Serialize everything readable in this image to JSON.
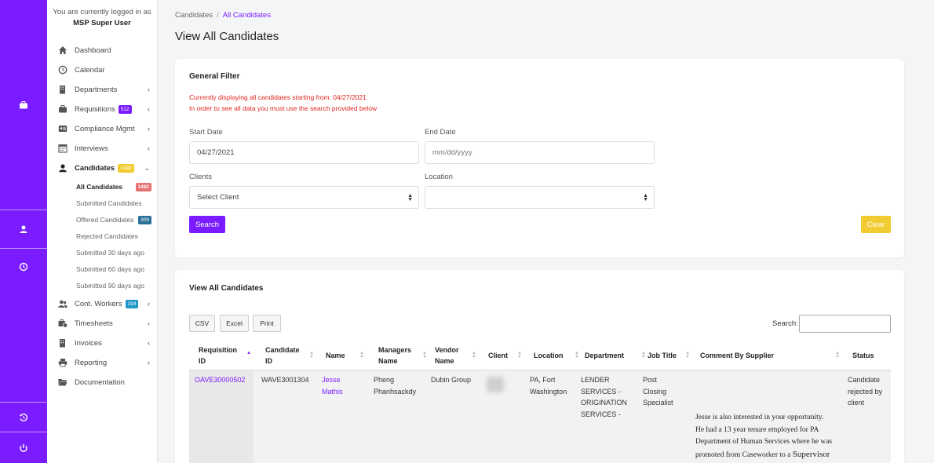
{
  "sidebar": {
    "login_note": "You are currently logged in as",
    "user": "MSP Super User",
    "items": [
      {
        "label": "Dashboard"
      },
      {
        "label": "Calendar"
      },
      {
        "label": "Departments"
      },
      {
        "label": "Requisitions",
        "badge": "512"
      },
      {
        "label": "Compliance Mgmt"
      },
      {
        "label": "Interviews"
      },
      {
        "label": "Candidates",
        "badge": "1492"
      },
      {
        "label": "Cont. Workers",
        "badge": "194"
      },
      {
        "label": "Timesheets"
      },
      {
        "label": "Invoices"
      },
      {
        "label": "Reporting"
      },
      {
        "label": "Documentation"
      }
    ],
    "sub_items": [
      {
        "label": "All Candidates",
        "badge": "1492"
      },
      {
        "label": "Submitted Candidates"
      },
      {
        "label": "Offered Candidates",
        "badge": "309"
      },
      {
        "label": "Rejected Candidates"
      },
      {
        "label": "Submitted 30 days ago"
      },
      {
        "label": "Submitted 60 days ago"
      },
      {
        "label": "Submitted 90 days ago"
      }
    ],
    "colors": {
      "badge_purple": "#7a1cff",
      "badge_yellow": "#f1cb32",
      "badge_red": "#e87171",
      "badge_teal": "#2a6f97",
      "badge_blue": "#2196c9"
    }
  },
  "rail": {
    "icons": [
      "briefcase-icon",
      "user-icon",
      "clock-icon",
      "history-icon",
      "power-icon"
    ],
    "accent": "#7a1cff"
  },
  "breadcrumb": {
    "root": "Candidates",
    "separator": "/",
    "current": "All Candidates"
  },
  "page_title": "View All Candidates",
  "filter": {
    "title": "General Filter",
    "notice_line1": "Currently displaying all candidates starting from: 04/27/2021",
    "notice_line2": "In order to see all data you must use the search provided below",
    "start_date_label": "Start Date",
    "start_date_value": "04/27/2021",
    "end_date_label": "End Date",
    "end_date_placeholder": "mm/dd/yyyy",
    "clients_label": "Clients",
    "clients_value": "Select Client",
    "location_label": "Location",
    "location_value": "",
    "search_button": "Search",
    "clear_button": "Clear"
  },
  "list": {
    "title": "View All Candidates",
    "export_buttons": [
      "CSV",
      "Excel",
      "Print"
    ],
    "search_label": "Search:",
    "columns": [
      {
        "line1": "Requisition",
        "line2": "ID"
      },
      {
        "line1": "Candidate",
        "line2": "ID"
      },
      {
        "line1": "Name",
        "line2": ""
      },
      {
        "line1": "Managers",
        "line2": "Name"
      },
      {
        "line1": "Vendor",
        "line2": "Name"
      },
      {
        "line1": "Client",
        "line2": ""
      },
      {
        "line1": "Location",
        "line2": ""
      },
      {
        "line1": "Department",
        "line2": ""
      },
      {
        "line1": "Job Title",
        "line2": ""
      },
      {
        "line1": "Comment By Supplier",
        "line2": ""
      },
      {
        "line1": "Status",
        "line2": ""
      }
    ],
    "rows": [
      {
        "requisition_id": "OAVE30000502",
        "candidate_id": "WAVE3001304",
        "name": [
          "Jesse",
          "Mathis"
        ],
        "manager": [
          "Pheng",
          "Phanhsackdy"
        ],
        "vendor": "Dubin Group",
        "location": [
          "PA, Fort",
          "Washington"
        ],
        "department": [
          "LENDER",
          "SERVICES -",
          "ORIGINATION",
          "SERVICES -"
        ],
        "job_title": [
          "Post",
          "Closing",
          "Specialist"
        ],
        "comment": [
          "Jesse is also interested in your opportunity.",
          "He had a 13 year tenure employed for PA",
          "Department of Human Services where he was",
          "promoted from Caseworker to a"
        ],
        "comment_emph": "Supervisor",
        "status": [
          "Candidate",
          "rejected by",
          "client"
        ]
      }
    ]
  }
}
